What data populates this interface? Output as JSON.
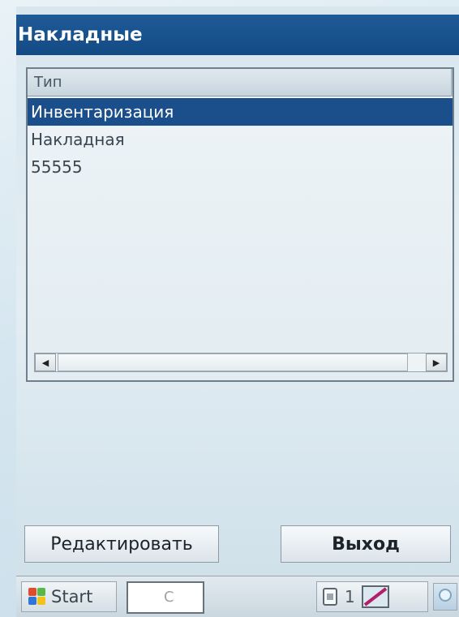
{
  "window": {
    "title": "Накладные"
  },
  "listview": {
    "column_header": "Тип",
    "rows": [
      {
        "label": "Инвентаризация",
        "selected": true
      },
      {
        "label": "Накладная",
        "selected": false
      },
      {
        "label": "55555",
        "selected": false
      }
    ]
  },
  "buttons": {
    "edit_label": "Редактировать",
    "exit_label": "Выход"
  },
  "taskbar": {
    "start_label": "Start",
    "input_value": "C",
    "tray_count": "1"
  },
  "colors": {
    "titlebar": "#1a4f8c",
    "selection": "#1a4f8c"
  },
  "icons": {
    "start": "windows-flag-icon",
    "tray_sim": "sim-card-icon",
    "tray_network": "network-connection-icon",
    "scroll_left": "triangle-left-icon",
    "scroll_right": "triangle-right-icon"
  }
}
